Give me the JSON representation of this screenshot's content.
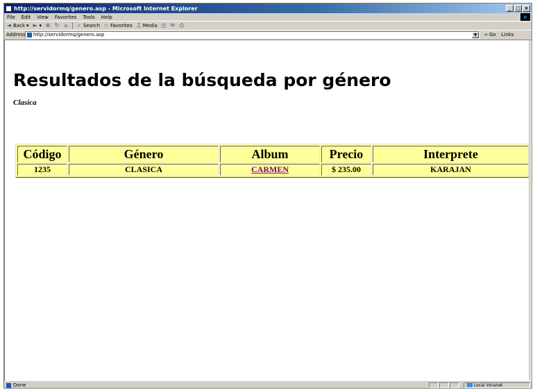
{
  "window": {
    "title": "http://servidormq/genero.asp - Microsoft Internet Explorer",
    "controls": {
      "minimize": "_",
      "maximize": "□",
      "close": "×"
    }
  },
  "menu": [
    "File",
    "Edit",
    "View",
    "Favorites",
    "Tools",
    "Help"
  ],
  "toolbar": {
    "back": "Back",
    "search": "Search",
    "favorites": "Favorites",
    "media": "Media"
  },
  "address": {
    "label": "Address",
    "url": "http://servidormq/genero.asp",
    "go": "Go",
    "links": "Links"
  },
  "page": {
    "title": "Resultados de la búsqueda por género",
    "genre": "Clasica",
    "table": {
      "headers": [
        "Código",
        "Género",
        "Album",
        "Precio",
        "Interprete"
      ],
      "rows": [
        [
          "1235",
          "CLASICA",
          "CARMEN",
          "$ 235.00",
          "KARAJAN"
        ]
      ]
    }
  },
  "status": {
    "text": "Done",
    "zone": "Local intranet"
  },
  "colors": {
    "table_bg": "#ffff99",
    "link_visited": "#800080",
    "titlebar": "#0a246a"
  }
}
